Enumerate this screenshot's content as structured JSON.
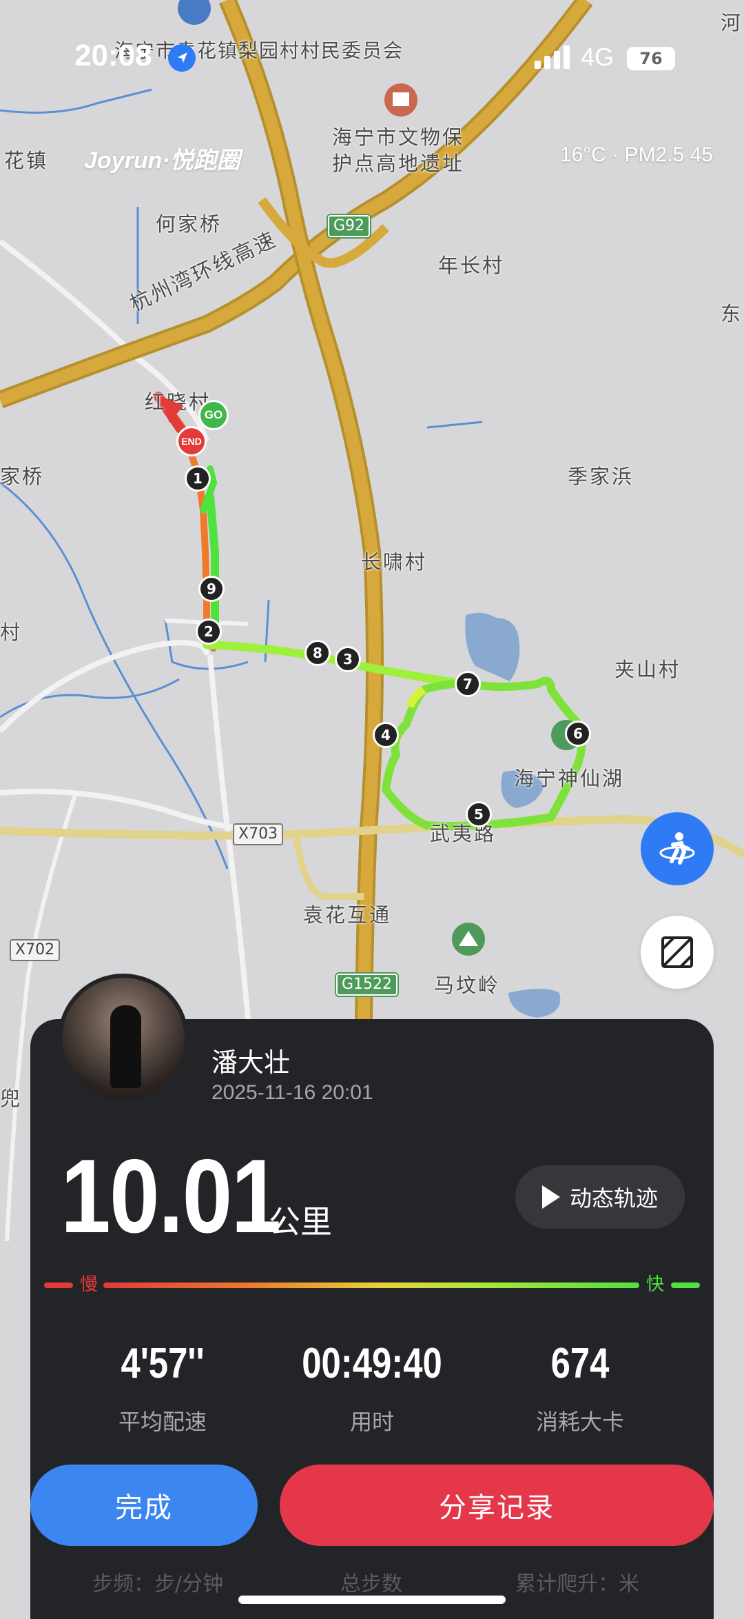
{
  "status_bar": {
    "time": "20:08",
    "network": "4G",
    "battery": "76"
  },
  "header": {
    "brand": "Joyrun·悦跑圈",
    "weather": "16°C · PM2.5 45"
  },
  "map": {
    "labels": [
      "海宁市袁花镇梨园村村民委员会",
      "海宁市文物保护点高地遗址",
      "花镇",
      "何家桥",
      "年长村",
      "杭州湾环线高速",
      "红晓村",
      "季家浜",
      "长啸村",
      "夹山村",
      "海宁神仙湖",
      "武夷路",
      "袁花互通",
      "马坟岭",
      "东",
      "家桥",
      "村",
      "兜",
      "河"
    ],
    "road_badges": [
      "G92",
      "X703",
      "X702",
      "G1522"
    ],
    "markers": {
      "start": "GO",
      "end": "END",
      "km": [
        "1",
        "2",
        "3",
        "4",
        "5",
        "6",
        "7",
        "8",
        "9"
      ]
    }
  },
  "profile": {
    "name": "潘大壮",
    "datetime": "2025-11-16 20:01"
  },
  "summary": {
    "distance": "10.01",
    "unit": "公里",
    "replay_label": "动态轨迹",
    "speed_slow": "慢",
    "speed_fast": "快"
  },
  "stats": [
    {
      "value": "4'57''",
      "label": "平均配速"
    },
    {
      "value": "00:49:40",
      "label": "用时"
    },
    {
      "value": "674",
      "label": "消耗大卡"
    }
  ],
  "actions": {
    "done": "完成",
    "share": "分享记录"
  },
  "faded_row": [
    "步频：步/分钟",
    "总步数",
    "累计爬升：米"
  ],
  "colors": {
    "done": "#3b86f0",
    "share": "#e4384a",
    "card": "#222427",
    "route_fast": "#4fe23f",
    "route_slow": "#e33a3a"
  }
}
